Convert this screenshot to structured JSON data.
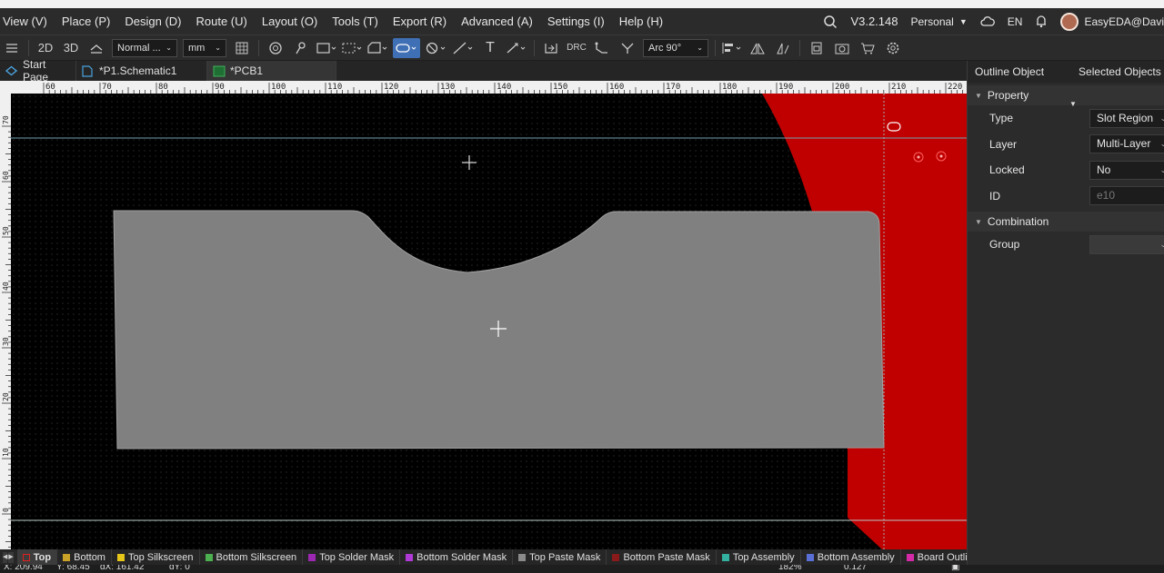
{
  "menu": {
    "items": [
      "View (V)",
      "Place (P)",
      "Design (D)",
      "Route (U)",
      "Layout (O)",
      "Tools (T)",
      "Export (R)",
      "Advanced (A)",
      "Settings (I)",
      "Help (H)"
    ],
    "version": "V3.2.148",
    "edition": "Personal",
    "language": "EN",
    "user": "EasyEDA@Davi"
  },
  "toolbar": {
    "view_2d": "2D",
    "view_3d": "3D",
    "routing_mode": "Normal ...",
    "unit": "mm",
    "drc_label": "DRC",
    "arc_mode": "Arc 90°"
  },
  "tabs": [
    {
      "label": "Start Page"
    },
    {
      "label": "*P1.Schematic1"
    },
    {
      "label": "*PCB1"
    }
  ],
  "ruler": {
    "top_labels": [
      "60",
      "70",
      "80",
      "90",
      "100",
      "110",
      "120",
      "130",
      "140",
      "150",
      "160",
      "170",
      "180",
      "190",
      "200",
      "210",
      "220"
    ],
    "left_labels": [
      "70",
      "60",
      "50",
      "40",
      "30",
      "20",
      "10",
      "0"
    ]
  },
  "panel": {
    "tab_outline": "Outline Object",
    "tab_selected": "Selected Objects",
    "property_header": "Property",
    "type_label": "Type",
    "type_value": "Slot Region",
    "layer_label": "Layer",
    "layer_value": "Multi-Layer",
    "locked_label": "Locked",
    "locked_value": "No",
    "id_label": "ID",
    "id_value": "e10",
    "combination_header": "Combination",
    "group_label": "Group",
    "group_value": ""
  },
  "layers": [
    {
      "name": "Top",
      "color": "#e02020",
      "active": true
    },
    {
      "name": "Bottom",
      "color": "#c9a227"
    },
    {
      "name": "Top Silkscreen",
      "color": "#e6c619"
    },
    {
      "name": "Bottom Silkscreen",
      "color": "#4caf50"
    },
    {
      "name": "Top Solder Mask",
      "color": "#9c27b0"
    },
    {
      "name": "Bottom Solder Mask",
      "color": "#b03ad6"
    },
    {
      "name": "Top Paste Mask",
      "color": "#8a8a8a"
    },
    {
      "name": "Bottom Paste Mask",
      "color": "#8a1a1a"
    },
    {
      "name": "Top Assembly",
      "color": "#33b0a0"
    },
    {
      "name": "Bottom Assembly",
      "color": "#5a6fd6"
    },
    {
      "name": "Board Outli",
      "color": "#d42aa8"
    }
  ],
  "status": {
    "x": "X: 209.94",
    "y": "Y: 68.45",
    "dx": "dX: 161.42",
    "dy": "dY: 0",
    "zoom": "182%",
    "grid": "0.127"
  },
  "colors": {
    "board": "#808080",
    "copper_fill": "#c00000",
    "canvas": "#000000",
    "accent": "#3f6fb5"
  }
}
